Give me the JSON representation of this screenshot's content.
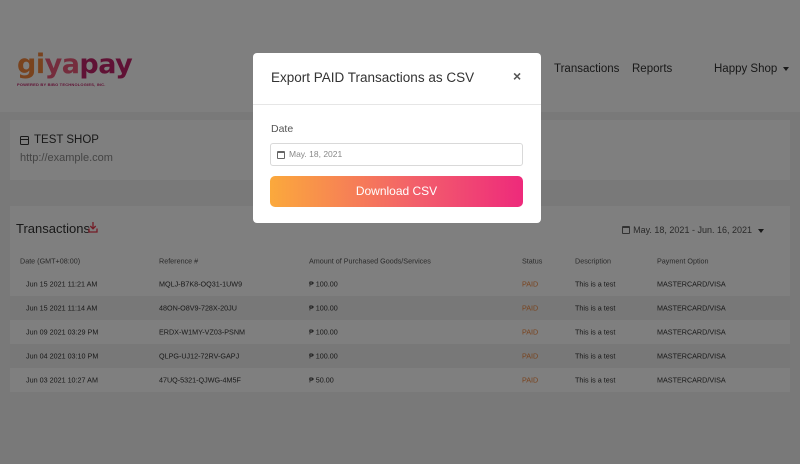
{
  "brand": {
    "logo_g": "gi",
    "logo_y": "ya",
    "logo_p": "pay",
    "tagline": "POWERED BY BIBO TECHNOLOGIES, INC."
  },
  "nav": {
    "transactions": "Transactions",
    "reports": "Reports",
    "user_menu": "Happy Shop"
  },
  "shop": {
    "name": "TEST SHOP",
    "url": "http://example.com"
  },
  "transactions": {
    "title": "Transactions",
    "date_range": "May. 18, 2021 - Jun. 16, 2021",
    "columns": [
      "Date (GMT+08:00)",
      "Reference #",
      "Amount of Purchased Goods/Services",
      "Status",
      "Description",
      "Payment Option"
    ],
    "rows": [
      [
        "Jun 15 2021 11:21 AM",
        "MQLJ-B7K8-OQ31-1UW9",
        "₱ 100.00",
        "PAID",
        "This is a test",
        "MASTERCARD/VISA"
      ],
      [
        "Jun 15 2021 11:14 AM",
        "48ON-O8V9-728X-20JU",
        "₱ 100.00",
        "PAID",
        "This is a test",
        "MASTERCARD/VISA"
      ],
      [
        "Jun 09 2021 03:29 PM",
        "ERDX-W1MY-VZ03-PSNM",
        "₱ 100.00",
        "PAID",
        "This is a test",
        "MASTERCARD/VISA"
      ],
      [
        "Jun 04 2021 03:10 PM",
        "QLPG-UJ12-72RV-GAPJ",
        "₱ 100.00",
        "PAID",
        "This is a test",
        "MASTERCARD/VISA"
      ],
      [
        "Jun 03 2021 10:27 AM",
        "47UQ-5321-QJWG-4M5F",
        "₱ 50.00",
        "PAID",
        "This is a test",
        "MASTERCARD/VISA"
      ]
    ]
  },
  "modal": {
    "title": "Export PAID Transactions as CSV",
    "close": "×",
    "date_label": "Date",
    "date_value": "May. 18, 2021",
    "button": "Download CSV"
  },
  "colors": {
    "accent_start": "#fba93c",
    "accent_end": "#ee2a7b",
    "status_paid": "#f2873d"
  }
}
